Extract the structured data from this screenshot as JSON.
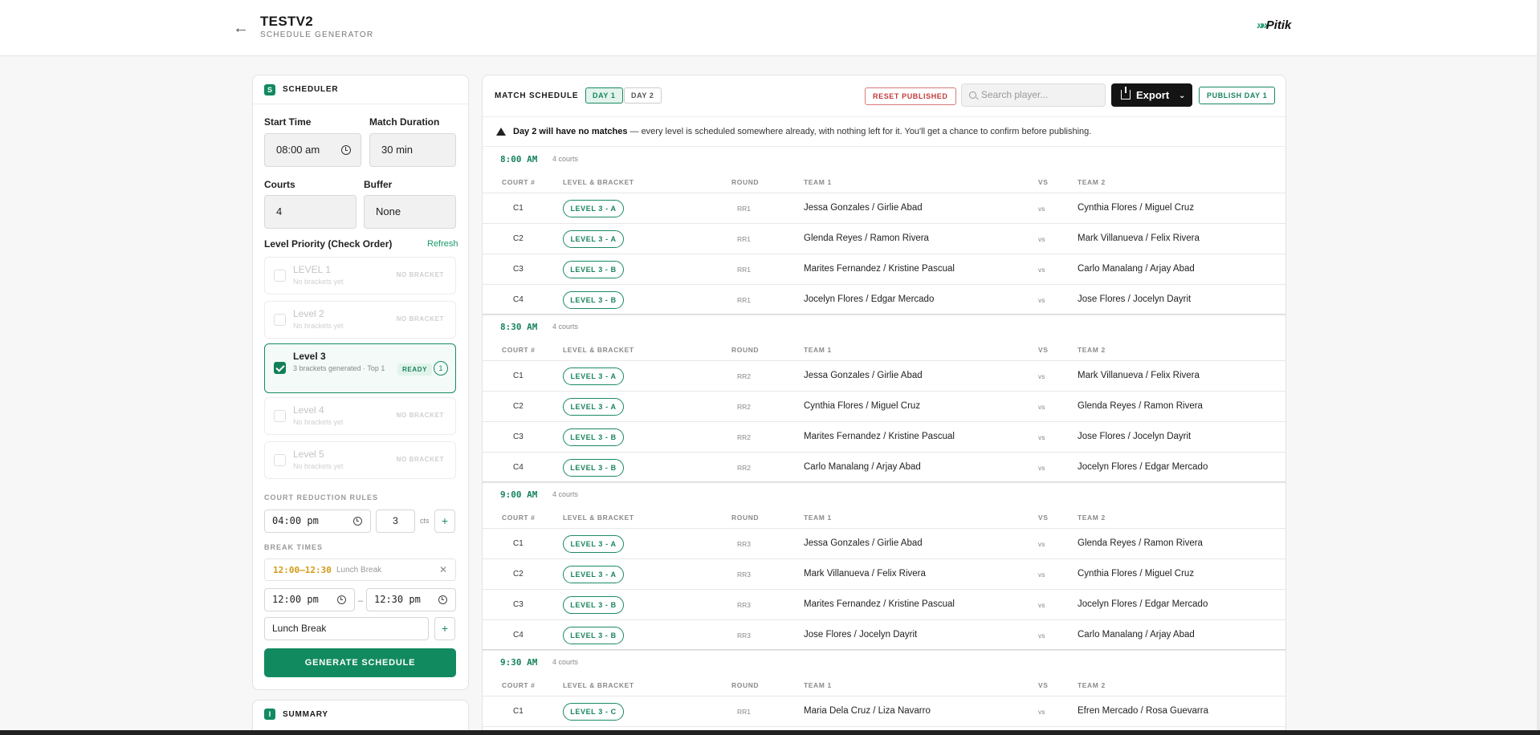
{
  "header": {
    "title": "TESTV2",
    "subtitle": "SCHEDULE GENERATOR",
    "logo_text": "Pitik"
  },
  "scheduler": {
    "badge": "S",
    "title": "SCHEDULER",
    "start_time_label": "Start Time",
    "start_time_value": "08:00 am",
    "match_duration_label": "Match Duration",
    "match_duration_value": "30 min",
    "courts_label": "Courts",
    "courts_value": "4",
    "buffer_label": "Buffer",
    "buffer_value": "None",
    "level_priority_label": "Level Priority (Check Order)",
    "refresh_label": "Refresh",
    "levels": [
      {
        "name": "LEVEL 1",
        "desc": "No brackets yet",
        "status": "NO BRACKET"
      },
      {
        "name": "Level 2",
        "desc": "No brackets yet",
        "status": "NO BRACKET"
      },
      {
        "name": "Level 3",
        "desc": "3 brackets generated · Top 1",
        "status": "READY",
        "count": "1"
      },
      {
        "name": "Level 4",
        "desc": "No brackets yet",
        "status": "NO BRACKET"
      },
      {
        "name": "Level 5",
        "desc": "No brackets yet",
        "status": "NO BRACKET"
      }
    ],
    "court_reduction_label": "COURT REDUCTION RULES",
    "court_reduction_time": "04:00 pm",
    "court_reduction_courts": "3",
    "court_reduction_unit": "cts",
    "break_times_label": "BREAK TIMES",
    "break_chip_time": "12:00–12:30",
    "break_chip_name": "Lunch Break",
    "break_start": "12:00 pm",
    "break_end": "12:30 pm",
    "break_name_value": "Lunch Break",
    "generate_label": "GENERATE SCHEDULE"
  },
  "summary": {
    "badge": "I",
    "title": "SUMMARY"
  },
  "schedule": {
    "title": "MATCH SCHEDULE",
    "day1": "DAY 1",
    "day2": "DAY 2",
    "reset_label": "RESET PUBLISHED",
    "search_placeholder": "Search player...",
    "export_label": "Export",
    "publish_label": "PUBLISH DAY 1",
    "warning_bold": "Day 2 will have no matches",
    "warning_text": " — every level is scheduled somewhere already, with nothing left for it. You'll get a chance to confirm before publishing.",
    "columns": {
      "court": "COURT #",
      "level": "LEVEL & BRACKET",
      "round": "ROUND",
      "team1": "TEAM 1",
      "vs": "VS",
      "team2": "TEAM 2"
    },
    "slots": [
      {
        "time": "8:00 AM",
        "courts": "4 courts",
        "rows": [
          {
            "court": "C1",
            "level": "LEVEL 3 - A",
            "round": "RR1",
            "team1": "Jessa Gonzales / Girlie Abad",
            "vs": "vs",
            "team2": "Cynthia Flores / Miguel Cruz"
          },
          {
            "court": "C2",
            "level": "LEVEL 3 - A",
            "round": "RR1",
            "team1": "Glenda Reyes / Ramon Rivera",
            "vs": "vs",
            "team2": "Mark Villanueva / Felix Rivera"
          },
          {
            "court": "C3",
            "level": "LEVEL 3 - B",
            "round": "RR1",
            "team1": "Marites Fernandez / Kristine Pascual",
            "vs": "vs",
            "team2": "Carlo Manalang / Arjay Abad"
          },
          {
            "court": "C4",
            "level": "LEVEL 3 - B",
            "round": "RR1",
            "team1": "Jocelyn Flores / Edgar Mercado",
            "vs": "vs",
            "team2": "Jose Flores / Jocelyn Dayrit"
          }
        ]
      },
      {
        "time": "8:30 AM",
        "courts": "4 courts",
        "rows": [
          {
            "court": "C1",
            "level": "LEVEL 3 - A",
            "round": "RR2",
            "team1": "Jessa Gonzales / Girlie Abad",
            "vs": "vs",
            "team2": "Mark Villanueva / Felix Rivera"
          },
          {
            "court": "C2",
            "level": "LEVEL 3 - A",
            "round": "RR2",
            "team1": "Cynthia Flores / Miguel Cruz",
            "vs": "vs",
            "team2": "Glenda Reyes / Ramon Rivera"
          },
          {
            "court": "C3",
            "level": "LEVEL 3 - B",
            "round": "RR2",
            "team1": "Marites Fernandez / Kristine Pascual",
            "vs": "vs",
            "team2": "Jose Flores / Jocelyn Dayrit"
          },
          {
            "court": "C4",
            "level": "LEVEL 3 - B",
            "round": "RR2",
            "team1": "Carlo Manalang / Arjay Abad",
            "vs": "vs",
            "team2": "Jocelyn Flores / Edgar Mercado"
          }
        ]
      },
      {
        "time": "9:00 AM",
        "courts": "4 courts",
        "rows": [
          {
            "court": "C1",
            "level": "LEVEL 3 - A",
            "round": "RR3",
            "team1": "Jessa Gonzales / Girlie Abad",
            "vs": "vs",
            "team2": "Glenda Reyes / Ramon Rivera"
          },
          {
            "court": "C2",
            "level": "LEVEL 3 - A",
            "round": "RR3",
            "team1": "Mark Villanueva / Felix Rivera",
            "vs": "vs",
            "team2": "Cynthia Flores / Miguel Cruz"
          },
          {
            "court": "C3",
            "level": "LEVEL 3 - B",
            "round": "RR3",
            "team1": "Marites Fernandez / Kristine Pascual",
            "vs": "vs",
            "team2": "Jocelyn Flores / Edgar Mercado"
          },
          {
            "court": "C4",
            "level": "LEVEL 3 - B",
            "round": "RR3",
            "team1": "Jose Flores / Jocelyn Dayrit",
            "vs": "vs",
            "team2": "Carlo Manalang / Arjay Abad"
          }
        ]
      },
      {
        "time": "9:30 AM",
        "courts": "4 courts",
        "rows": [
          {
            "court": "C1",
            "level": "LEVEL 3 - C",
            "round": "RR1",
            "team1": "Maria Dela Cruz / Liza Navarro",
            "vs": "vs",
            "team2": "Efren Mercado / Rosa Guevarra"
          }
        ]
      }
    ]
  }
}
